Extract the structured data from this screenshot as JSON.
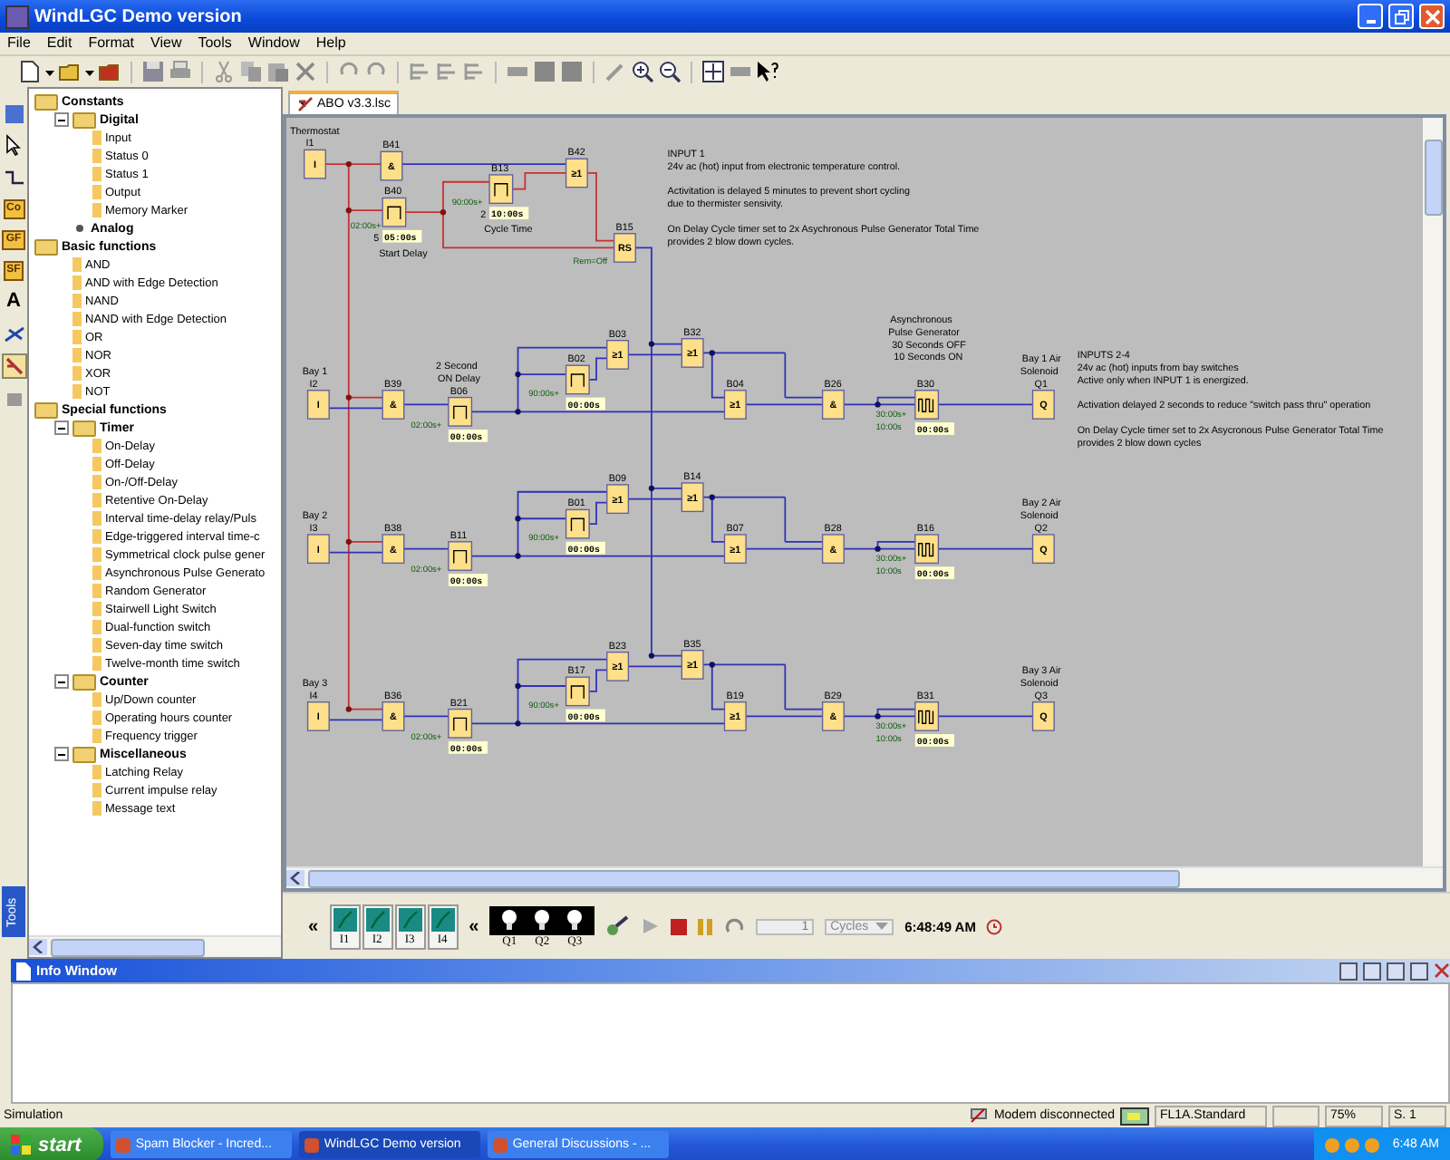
{
  "window": {
    "title": "WindLGC Demo version"
  },
  "menu": [
    "File",
    "Edit",
    "Format",
    "View",
    "Tools",
    "Window",
    "Help"
  ],
  "tool_labels": [
    "Co",
    "GF",
    "SF",
    "A"
  ],
  "tools_tab": "Tools",
  "sidebar": {
    "tree": [
      {
        "label": "Constants",
        "kind": "folder",
        "children": [
          {
            "label": "Digital",
            "kind": "folder",
            "expanded": true,
            "children": [
              {
                "label": "Input",
                "kind": "item"
              },
              {
                "label": "Status 0",
                "kind": "item"
              },
              {
                "label": "Status 1",
                "kind": "item"
              },
              {
                "label": "Output",
                "kind": "item"
              },
              {
                "label": "Memory Marker",
                "kind": "item"
              }
            ]
          },
          {
            "label": "Analog",
            "kind": "bullet"
          }
        ]
      },
      {
        "label": "Basic functions",
        "kind": "folder",
        "children": [
          {
            "label": "AND",
            "kind": "item"
          },
          {
            "label": "AND with Edge Detection",
            "kind": "item"
          },
          {
            "label": "NAND",
            "kind": "item"
          },
          {
            "label": "NAND with Edge Detection",
            "kind": "item"
          },
          {
            "label": "OR",
            "kind": "item"
          },
          {
            "label": "NOR",
            "kind": "item"
          },
          {
            "label": "XOR",
            "kind": "item"
          },
          {
            "label": "NOT",
            "kind": "item"
          }
        ]
      },
      {
        "label": "Special functions",
        "kind": "folder",
        "children": [
          {
            "label": "Timer",
            "kind": "folder",
            "expanded": true,
            "children": [
              {
                "label": "On-Delay",
                "kind": "item"
              },
              {
                "label": "Off-Delay",
                "kind": "item"
              },
              {
                "label": "On-/Off-Delay",
                "kind": "item"
              },
              {
                "label": "Retentive On-Delay",
                "kind": "item"
              },
              {
                "label": "Interval time-delay relay/Puls",
                "kind": "item"
              },
              {
                "label": "Edge-triggered interval time-c",
                "kind": "item"
              },
              {
                "label": "Symmetrical clock pulse gener",
                "kind": "item"
              },
              {
                "label": "Asynchronous Pulse Generato",
                "kind": "item"
              },
              {
                "label": "Random Generator",
                "kind": "item"
              },
              {
                "label": "Stairwell Light Switch",
                "kind": "item"
              },
              {
                "label": "Dual-function switch",
                "kind": "item"
              },
              {
                "label": "Seven-day time switch",
                "kind": "item"
              },
              {
                "label": "Twelve-month time switch",
                "kind": "item"
              }
            ]
          },
          {
            "label": "Counter",
            "kind": "folder",
            "expanded": true,
            "children": [
              {
                "label": "Up/Down counter",
                "kind": "item"
              },
              {
                "label": "Operating hours counter",
                "kind": "item"
              },
              {
                "label": "Frequency trigger",
                "kind": "item"
              }
            ]
          },
          {
            "label": "Miscellaneous",
            "kind": "folder",
            "expanded": true,
            "children": [
              {
                "label": "Latching Relay",
                "kind": "item"
              },
              {
                "label": "Current impulse relay",
                "kind": "item"
              },
              {
                "label": "Message text",
                "kind": "item"
              }
            ]
          }
        ]
      }
    ]
  },
  "tabs": [
    {
      "label": "ABO v3.3.lsc",
      "selected": true
    }
  ],
  "diagram": {
    "blocks": [
      {
        "label": "I1",
        "kind": "input",
        "symbol": "I"
      },
      {
        "label": "B41",
        "kind": "gate",
        "symbol": "&"
      },
      {
        "label": "B40",
        "kind": "timer",
        "params": [
          "02:00s+"
        ],
        "value": "05:00s"
      },
      {
        "label": "B13",
        "kind": "timer",
        "params": [
          "90:00s+"
        ],
        "value": "10:00s"
      },
      {
        "label": "B42",
        "kind": "gate",
        "symbol": "≥1"
      },
      {
        "label": "B15",
        "kind": "rs",
        "symbol": "RS",
        "params": [
          "Rem=Off"
        ]
      },
      {
        "label": "I2",
        "kind": "input",
        "symbol": "I"
      },
      {
        "label": "B39",
        "kind": "gate",
        "symbol": "&"
      },
      {
        "label": "B06",
        "kind": "timer",
        "params": [
          "02:00s+"
        ],
        "value": "00:00s"
      },
      {
        "label": "B02",
        "kind": "timer",
        "params": [
          "90:00s+"
        ],
        "value": "00:00s"
      },
      {
        "label": "B03",
        "kind": "gate",
        "symbol": "≥1"
      },
      {
        "label": "B32",
        "kind": "gate",
        "symbol": "≥1"
      },
      {
        "label": "B04",
        "kind": "gate",
        "symbol": "≥1"
      },
      {
        "label": "B26",
        "kind": "gate",
        "symbol": "&"
      },
      {
        "label": "B30",
        "kind": "pulse",
        "params": [
          "30:00s+",
          "10:00s"
        ],
        "value": "00:00s"
      },
      {
        "label": "Q1",
        "kind": "output",
        "symbol": "Q"
      },
      {
        "label": "I3",
        "kind": "input",
        "symbol": "I"
      },
      {
        "label": "B38",
        "kind": "gate",
        "symbol": "&"
      },
      {
        "label": "B11",
        "kind": "timer",
        "params": [
          "02:00s+"
        ],
        "value": "00:00s"
      },
      {
        "label": "B01",
        "kind": "timer",
        "params": [
          "90:00s+"
        ],
        "value": "00:00s"
      },
      {
        "label": "B09",
        "kind": "gate",
        "symbol": "≥1"
      },
      {
        "label": "B14",
        "kind": "gate",
        "symbol": "≥1"
      },
      {
        "label": "B07",
        "kind": "gate",
        "symbol": "≥1"
      },
      {
        "label": "B28",
        "kind": "gate",
        "symbol": "&"
      },
      {
        "label": "B16",
        "kind": "pulse",
        "params": [
          "30:00s+",
          "10:00s"
        ],
        "value": "00:00s"
      },
      {
        "label": "Q2",
        "kind": "output",
        "symbol": "Q"
      },
      {
        "label": "I4",
        "kind": "input",
        "symbol": "I"
      },
      {
        "label": "B36",
        "kind": "gate",
        "symbol": "&"
      },
      {
        "label": "B21",
        "kind": "timer",
        "params": [
          "02:00s+"
        ],
        "value": "00:00s"
      },
      {
        "label": "B17",
        "kind": "timer",
        "params": [
          "90:00s+"
        ],
        "value": "00:00s"
      },
      {
        "label": "B23",
        "kind": "gate",
        "symbol": "≥1"
      },
      {
        "label": "B35",
        "kind": "gate",
        "symbol": "≥1"
      },
      {
        "label": "B19",
        "kind": "gate",
        "symbol": "≥1"
      },
      {
        "label": "B29",
        "kind": "gate",
        "symbol": "&"
      },
      {
        "label": "B31",
        "kind": "pulse",
        "params": [
          "30:00s+",
          "10:00s"
        ],
        "value": "00:00s"
      },
      {
        "label": "Q3",
        "kind": "output",
        "symbol": "Q"
      }
    ],
    "captions": [
      "Thermostat",
      "5",
      "Start Delay",
      "2",
      "Cycle Time",
      "Bay 1",
      "2 Second",
      "ON Delay",
      "Asynchronous",
      "Pulse Generator",
      "30 Seconds OFF",
      "10 Seconds ON",
      "Bay 1 Air",
      "Solenoid",
      "Bay 2",
      "Bay 2 Air",
      "Solenoid",
      "Bay 3",
      "Bay 3 Air",
      "Solenoid"
    ],
    "notes": [
      [
        [
          "INPUT 1",
          "24v ac (hot) input from electronic temperature control."
        ],
        [
          "Activitation is delayed 5 minutes to prevent short cycling",
          "due to thermister sensivity."
        ],
        [
          "On Delay Cycle timer set to 2x Asychronous Pulse Generator Total Time",
          "provides 2 blow down cycles."
        ]
      ],
      [
        [
          "INPUTS 2-4",
          "24v ac (hot) inputs from bay switches",
          "Active only when INPUT 1 is energized."
        ],
        [
          "Activation delayed 2 seconds to reduce \"switch pass thru\" operation"
        ],
        [
          "On Delay Cycle timer set to 2x Asycronous Pulse Generator Total Time",
          "provides 2 blow down cycles"
        ]
      ]
    ]
  },
  "simulation": {
    "toggle_inputs": "«",
    "inputs": [
      "I1",
      "I2",
      "I3",
      "I4"
    ],
    "toggle_outputs": "«",
    "outputs": [
      "Q1",
      "Q2",
      "Q3"
    ],
    "cycles_value": "1",
    "cycles_unit": "Cycles",
    "time": "6:48:49 AM"
  },
  "info_window": {
    "title": "Info Window"
  },
  "status_bar": [
    "Simulation",
    "Modem disconnected",
    "FL1A.Standard",
    "75%",
    "S. 1"
  ],
  "taskbar": {
    "start": "start",
    "tasks": [
      {
        "label": "Spam Blocker - Incred...",
        "selected": false
      },
      {
        "label": "WindLGC Demo version",
        "selected": true
      },
      {
        "label": "General Discussions - ...",
        "selected": false
      }
    ],
    "clock": "6:48 AM"
  }
}
